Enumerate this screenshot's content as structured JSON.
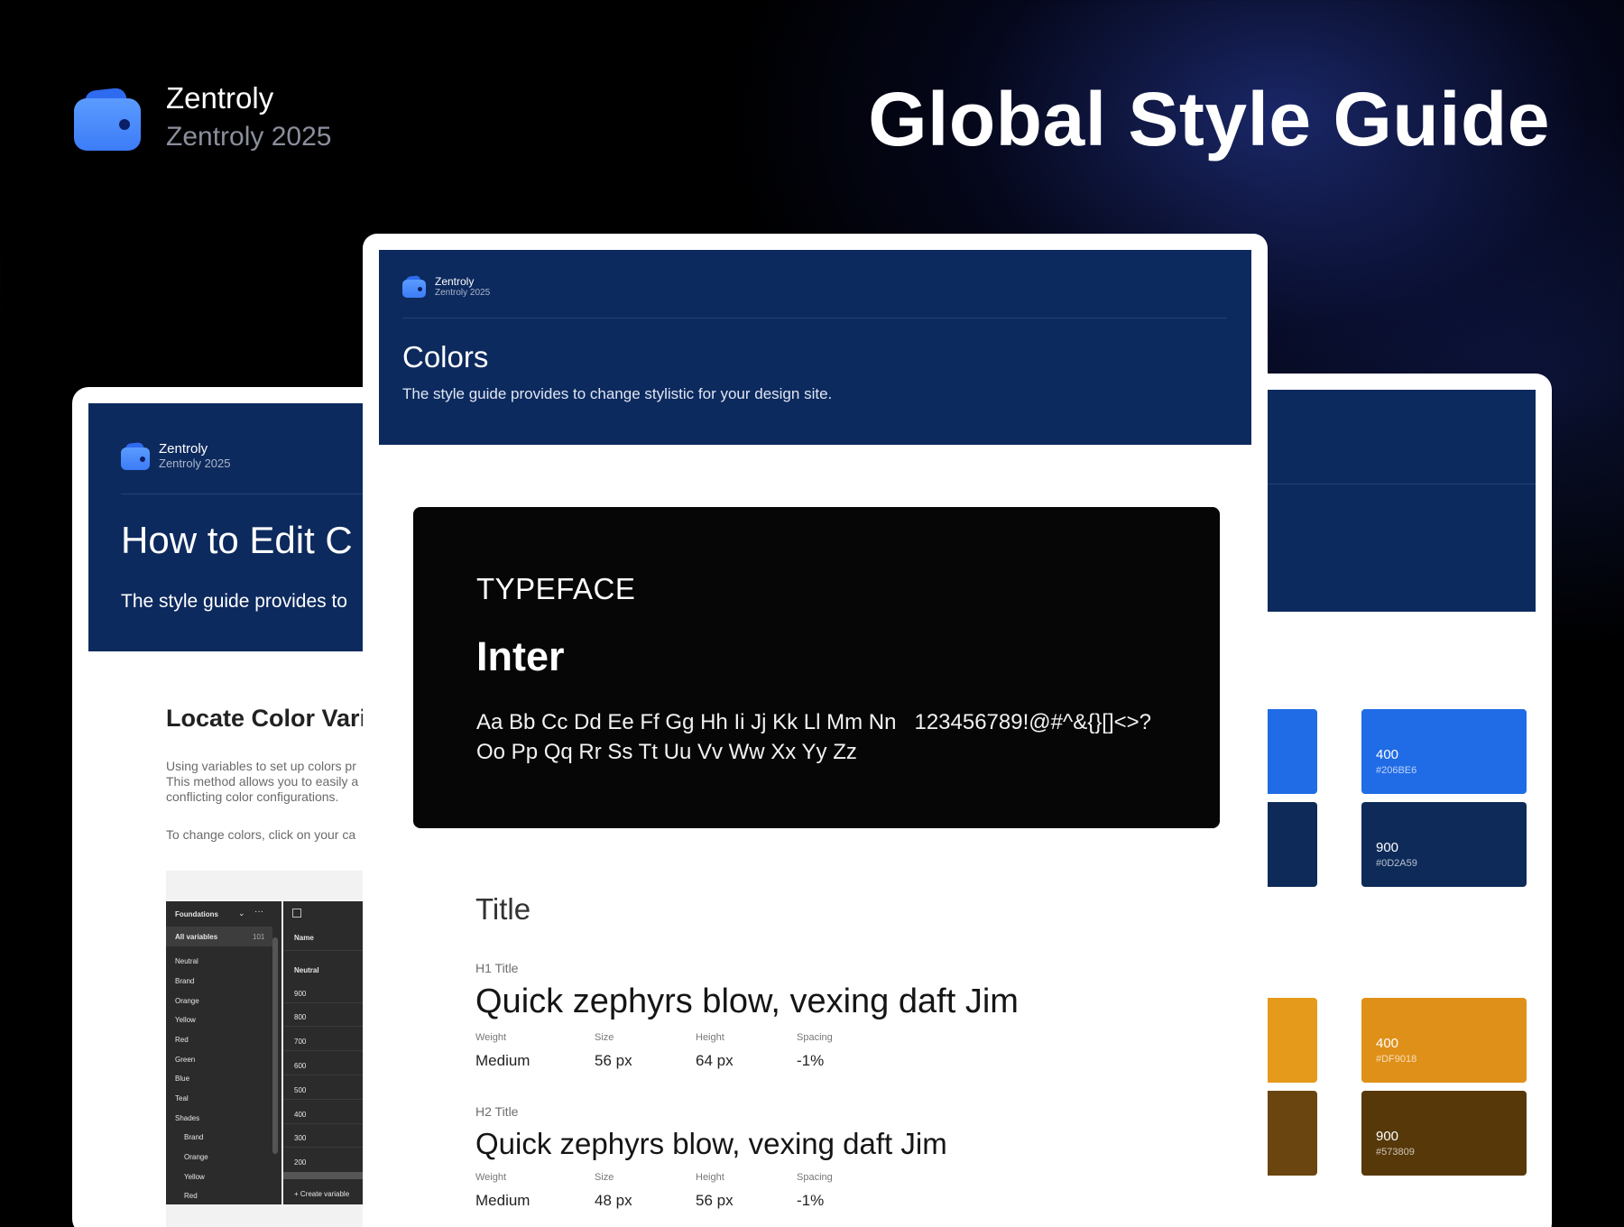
{
  "brand": {
    "name": "Zentroly",
    "subtitle": "Zentroly 2025"
  },
  "hero_title": "Global Style Guide",
  "left_card": {
    "brand_name": "Zentroly",
    "brand_sub": "Zentroly 2025",
    "title": "How to Edit C",
    "subtitle": "The style guide provides to",
    "section_title": "Locate Color Vari",
    "paragraph_lines": [
      "Using variables to set up colors pr",
      "This method allows you to easily a",
      "conflicting color configurations."
    ],
    "paragraph2": "To change colors, click on your ca",
    "panel": {
      "header": "Foundations",
      "all_variables": "All variables",
      "count": "101",
      "groups": [
        "Neutral",
        "Brand",
        "Orange",
        "Yellow",
        "Red",
        "Green",
        "Blue",
        "Teal",
        "Shades"
      ],
      "shade_groups": [
        "Brand",
        "Orange",
        "Yellow",
        "Red"
      ],
      "col_name": "Name",
      "neutral_group": "Neutral",
      "values": [
        "900",
        "800",
        "700",
        "600",
        "500",
        "400",
        "300",
        "200"
      ],
      "create": "+  Create variable"
    }
  },
  "right_card": {
    "swatches": [
      {
        "label": "400",
        "hex": "#206BE6",
        "color": "#206be6"
      },
      {
        "label": "900",
        "hex": "#0D2A59",
        "color": "#0d2a59"
      },
      {
        "label": "400",
        "hex": "#DF9018",
        "color": "#df9018"
      },
      {
        "label": "900",
        "hex": "#573809",
        "color": "#573809"
      }
    ]
  },
  "center_card": {
    "brand_name": "Zentroly",
    "brand_sub": "Zentroly 2025",
    "title": "Colors",
    "subtitle": "The style guide provides to change stylistic for your design site.",
    "typeface_label": "TYPEFACE",
    "typeface_name": "Inter",
    "glyphs_line1": "Aa Bb Cc Dd Ee Ff Gg Hh Ii Jj Kk Ll Mm Nn   123456789!@#^&{}[]<>?",
    "glyphs_line2": "Oo Pp Qq Rr Ss Tt Uu Vv Ww Xx Yy Zz",
    "section_title": "Title",
    "styles": [
      {
        "label": "H1 Title",
        "sample": "Quick zephyrs blow, vexing daft Jim",
        "weight": "Medium",
        "size": "56 px",
        "height": "64 px",
        "spacing": "-1%"
      },
      {
        "label": "H2 Title",
        "sample": "Quick zephyrs blow, vexing daft Jim",
        "weight": "Medium",
        "size": "48 px",
        "height": "56 px",
        "spacing": "-1%"
      }
    ],
    "meta_keys": {
      "weight": "Weight",
      "size": "Size",
      "height": "Height",
      "spacing": "Spacing"
    }
  }
}
